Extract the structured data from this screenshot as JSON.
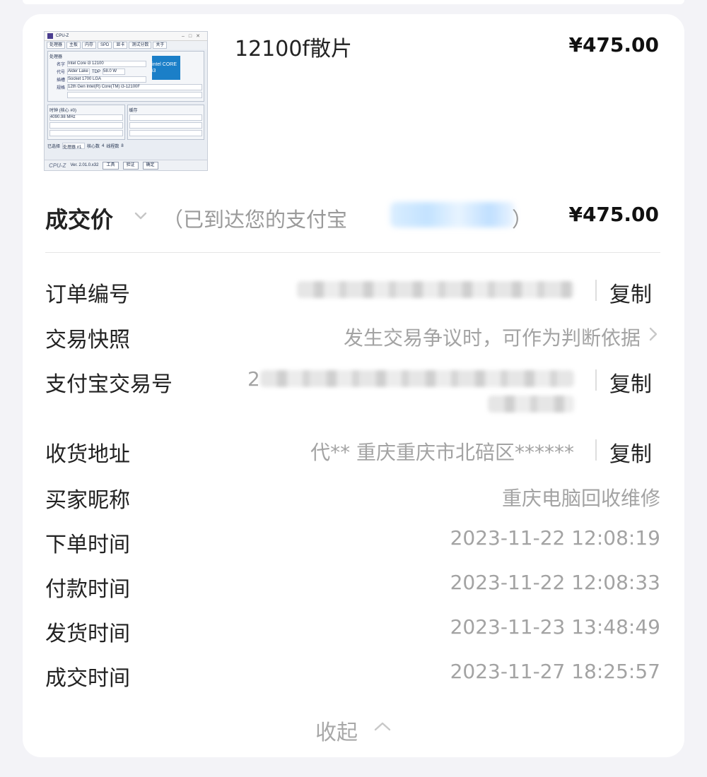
{
  "product": {
    "thumbnail": {
      "window_title": "CPU-Z",
      "tabs": [
        "处理器",
        "主板",
        "内存",
        "SPD",
        "显卡",
        "测试分数",
        "关于"
      ],
      "group_label": "处理器",
      "name_label": "名字",
      "name_value": "Intel Core i3 12100",
      "codename_label": "代号",
      "codename_value": "Alder Lake",
      "tdp_label": "TDP",
      "tdp_value": "58.0 W",
      "socket_label": "插槽",
      "socket_value": "Socket 1700 LGA",
      "spec_label": "规格",
      "spec_value": "12th Gen Intel(R) Core(TM) i3-12100F",
      "intel_badge": "intel CORE i3",
      "clock_group": "时钟 (核心 #0)",
      "core_speed": "4090.98 MHz",
      "cache_group": "缓存",
      "selected_label": "已选择",
      "selected_value": "处理器 #1",
      "cores_label": "核心数",
      "cores_value": "4",
      "threads_label": "线程数",
      "threads_value": "8",
      "brand": "CPU-Z",
      "version": "Ver. 2.01.0.x32",
      "tools_button": "工具",
      "validate_button": "验证",
      "ok_button": "确定"
    },
    "title": "12100f散片",
    "price": "¥475.00"
  },
  "deal": {
    "label": "成交价",
    "note": "（已到达您的支付宝",
    "note_close": "）",
    "price": "¥475.00"
  },
  "details": {
    "order_no": {
      "label": "订单编号",
      "copy": "复制"
    },
    "snapshot": {
      "label": "交易快照",
      "value": "发生交易争议时，可作为判断依据"
    },
    "alipay_no": {
      "label": "支付宝交易号",
      "prefix": "2",
      "copy": "复制"
    },
    "address": {
      "label": "收货地址",
      "value": "代** 重庆重庆市北碚区******",
      "copy": "复制"
    },
    "buyer": {
      "label": "买家昵称",
      "value": "重庆电脑回收维修"
    },
    "order_time": {
      "label": "下单时间",
      "value": "2023-11-22 12:08:19"
    },
    "pay_time": {
      "label": "付款时间",
      "value": "2023-11-22 12:08:33"
    },
    "ship_time": {
      "label": "发货时间",
      "value": "2023-11-23 13:48:49"
    },
    "deal_time": {
      "label": "成交时间",
      "value": "2023-11-27 18:25:57"
    }
  },
  "collapse_label": "收起"
}
